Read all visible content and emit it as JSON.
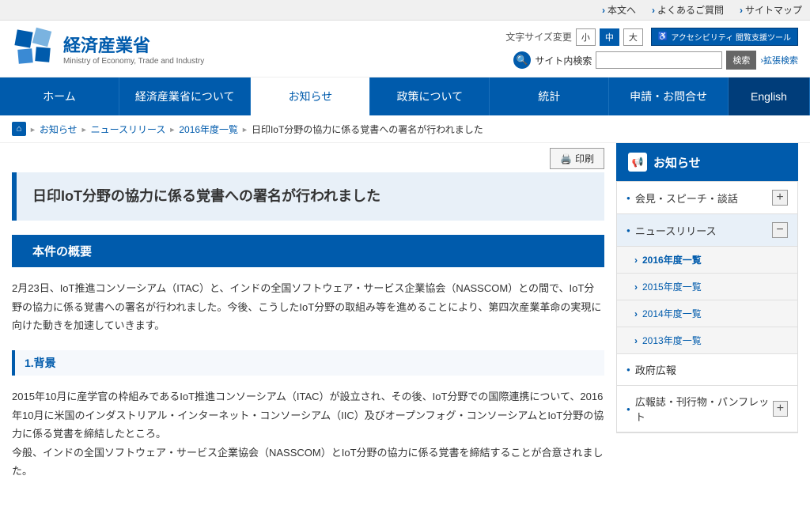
{
  "topBar": {
    "links": [
      {
        "id": "main-text",
        "label": "本文へ"
      },
      {
        "id": "faq",
        "label": "よくあるご質問"
      },
      {
        "id": "sitemap",
        "label": "サイトマップ"
      }
    ]
  },
  "header": {
    "logoTitle": "経済産業省",
    "logoSubtitle": "Ministry of Economy, Trade and Industry",
    "fontSizeLabel": "文字サイズ変更",
    "fontSizes": [
      "小",
      "中",
      "大"
    ],
    "activeFont": "中",
    "accessibilityLabel": "アクセシビリティ 閲覧支援ツール",
    "searchLabel": "サイト内検索",
    "searchPlaceholder": "",
    "searchBtnLabel": "検索",
    "extendedSearchLabel": "拡張検索"
  },
  "nav": {
    "items": [
      {
        "id": "home",
        "label": "ホーム",
        "active": false
      },
      {
        "id": "about",
        "label": "経済産業省について",
        "active": false
      },
      {
        "id": "news",
        "label": "お知らせ",
        "active": true
      },
      {
        "id": "policy",
        "label": "政策について",
        "active": false
      },
      {
        "id": "stats",
        "label": "統計",
        "active": false
      },
      {
        "id": "contact",
        "label": "申請・お問合せ",
        "active": false
      },
      {
        "id": "english",
        "label": "English",
        "active": false
      }
    ]
  },
  "breadcrumb": {
    "items": [
      {
        "id": "home",
        "label": ""
      },
      {
        "id": "oshirase",
        "label": "お知らせ"
      },
      {
        "id": "newsrelease",
        "label": "ニュースリリース"
      },
      {
        "id": "2016list",
        "label": "2016年度一覧"
      },
      {
        "id": "current",
        "label": "日印IoT分野の協力に係る覚書への署名が行われました"
      }
    ]
  },
  "print": {
    "label": "印刷"
  },
  "article": {
    "title": "日印IoT分野の協力に係る覚書への署名が行われました",
    "sectionHeading": "本件の概要",
    "bodyText": "2月23日、IoT推進コンソーシアム（ITAC）と、インドの全国ソフトウェア・サービス企業協会（NASSCOM）との間で、IoT分野の協力に係る覚書への署名が行われました。今後、こうしたIoT分野の取組み等を進めることにより、第四次産業革命の実現に向けた動きを加速していきます。",
    "subHeading": "1.背景",
    "backgroundText": "2015年10月に産学官の枠組みであるIoT推進コンソーシアム（ITAC）が設立され、その後、IoT分野での国際連携について、2016年10月に米国のインダストリアル・インターネット・コンソーシアム（IIC）及びオープンフォグ・コンソーシアムとIoT分野の協力に係る覚書を締結したところ。\n今般、インドの全国ソフトウェア・サービス企業協会（NASSCOM）とIoT分野の協力に係る覚書を締結することが合意されました。"
  },
  "sidebar": {
    "headerLabel": "お知らせ",
    "sections": [
      {
        "id": "meetings",
        "label": "会見・スピーチ・談話",
        "toggle": "+",
        "expanded": false
      },
      {
        "id": "newsrelease",
        "label": "ニュースリリース",
        "toggle": "−",
        "expanded": true,
        "subItems": [
          {
            "id": "2016",
            "label": "2016年度一覧",
            "active": true
          },
          {
            "id": "2015",
            "label": "2015年度一覧",
            "active": false
          },
          {
            "id": "2014",
            "label": "2014年度一覧",
            "active": false
          },
          {
            "id": "2013",
            "label": "2013年度一覧",
            "active": false
          }
        ]
      },
      {
        "id": "govt-pr",
        "label": "政府広報",
        "toggle": null,
        "expanded": false
      },
      {
        "id": "magazines",
        "label": "広報誌・刊行物・パンフレット",
        "toggle": "+",
        "expanded": false
      }
    ]
  }
}
